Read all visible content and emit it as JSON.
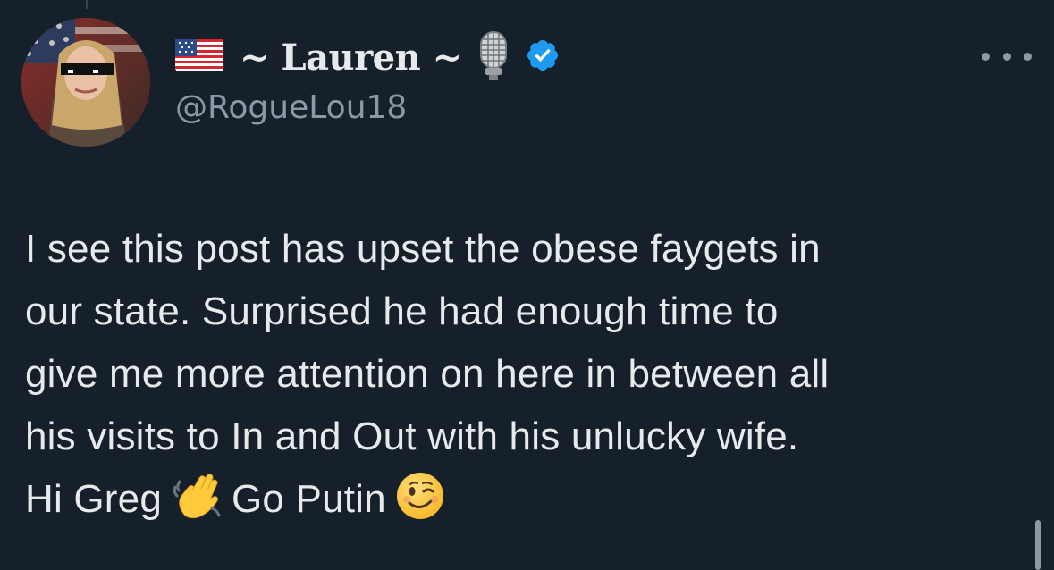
{
  "author": {
    "flag_emoji": "flag-us-icon",
    "display_name": "~ Lauren ~",
    "mic_emoji": "microphone-icon",
    "verified": true,
    "verified_color": "#1d9bf0",
    "handle": "@RogueLou18"
  },
  "tweet": {
    "lines": [
      "I see this post has upset the obese faygets in",
      "our state. Surprised he had enough time to",
      "give me more attention on here in between all",
      "his visits to In and Out with his unlucky wife."
    ],
    "last_line": {
      "part1": "Hi Greg",
      "emoji1": "waving-hand-icon",
      "part2": "Go Putin",
      "emoji2": "winking-face-icon"
    }
  },
  "colors": {
    "background": "#15202b",
    "primary_text": "#e7e9ea",
    "secondary_text": "#8b98a5"
  }
}
